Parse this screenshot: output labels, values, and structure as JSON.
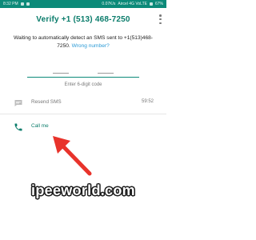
{
  "status_bar": {
    "time": "8:32 PM",
    "network_speed": "0.07K/s",
    "carrier": "Aircel 4G VoLTE",
    "battery": "67%"
  },
  "header": {
    "title": "Verify +1 (513) 468-7250",
    "menu_icon": "more-vert-icon"
  },
  "message": {
    "text": "Waiting to automatically detect an SMS sent to +1(513)468-7250.",
    "link": "Wrong number?",
    "link_color": "#2a9ad6"
  },
  "code_input": {
    "placeholder": "— — —   — — —",
    "label": "Enter 6-digit code"
  },
  "actions": {
    "resend": {
      "label": "Resend SMS",
      "timer": "59:52",
      "icon": "message-icon"
    },
    "call": {
      "label": "Call me",
      "icon": "phone-icon"
    }
  },
  "watermark": {
    "text": "ipeeworld.com"
  },
  "colors": {
    "accent": "#0a7c6b",
    "status_bar": "#0c8a79",
    "arrow": "#e8332b",
    "link": "#2a9ad6"
  }
}
